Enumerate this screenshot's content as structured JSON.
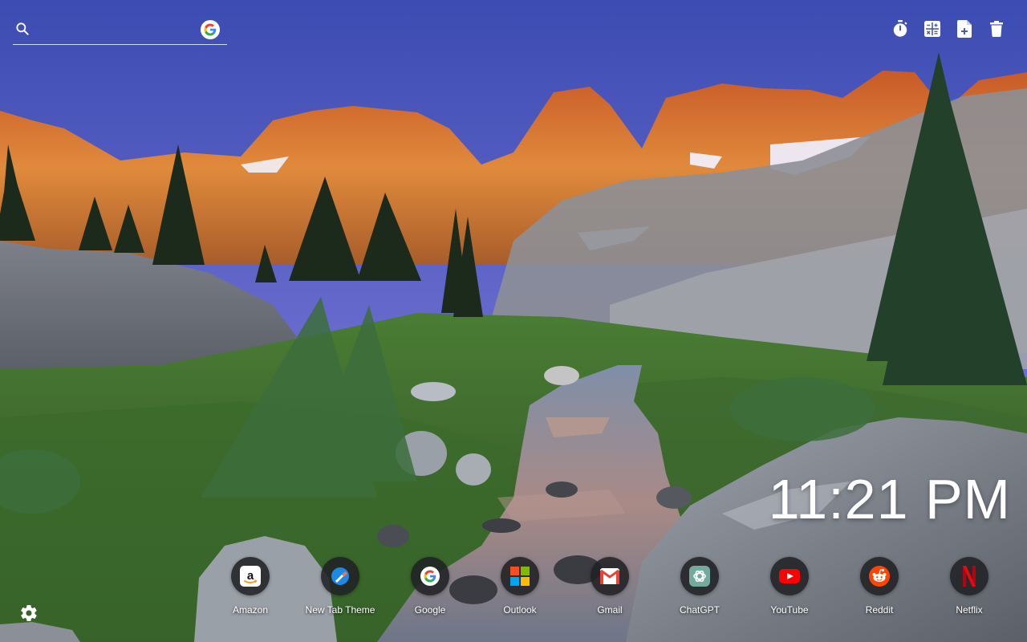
{
  "search": {
    "placeholder": "",
    "engine_icon": "google-icon"
  },
  "toolbar": {
    "items": [
      {
        "name": "timer",
        "icon": "timer-icon"
      },
      {
        "name": "calculator",
        "icon": "calculator-icon"
      },
      {
        "name": "new-note",
        "icon": "note-add-icon"
      },
      {
        "name": "delete",
        "icon": "trash-icon"
      }
    ]
  },
  "clock": {
    "time": "11:21 PM"
  },
  "shortcuts": [
    {
      "label": "Amazon",
      "icon": "amazon-icon"
    },
    {
      "label": "New Tab Theme",
      "icon": "new-tab-theme-icon"
    },
    {
      "label": "Google",
      "icon": "google-icon"
    },
    {
      "label": "Outlook",
      "icon": "microsoft-icon"
    },
    {
      "label": "Gmail",
      "icon": "gmail-icon"
    },
    {
      "label": "ChatGPT",
      "icon": "chatgpt-icon"
    },
    {
      "label": "YouTube",
      "icon": "youtube-icon"
    },
    {
      "label": "Reddit",
      "icon": "reddit-icon"
    },
    {
      "label": "Netflix",
      "icon": "netflix-icon"
    }
  ],
  "settings": {
    "icon": "gear-icon"
  },
  "colors": {
    "sky_top": "#3d4eb0",
    "sky_bottom": "#8f8fe0",
    "alpenglow": "#d9702a",
    "meadow": "#3f6a2e",
    "icon_bg": "#202124"
  }
}
